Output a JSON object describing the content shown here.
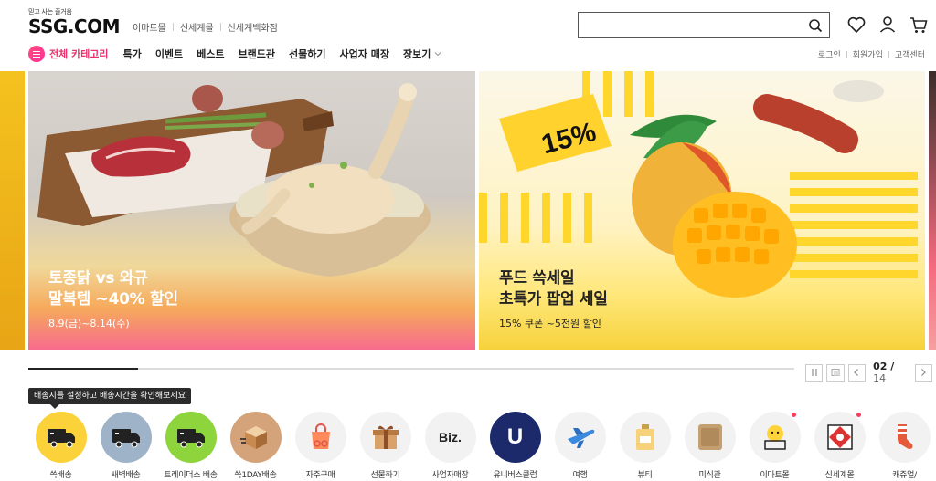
{
  "header": {
    "tagline": "믿고 사는 즐거움",
    "logo": "SSG.COM",
    "site_links": [
      "이마트몰",
      "신세계몰",
      "신세계백화점"
    ],
    "search": {
      "placeholder": "",
      "value": ""
    }
  },
  "nav": {
    "all_categories": "전체 카테고리",
    "items": [
      "특가",
      "이벤트",
      "베스트",
      "브랜드관",
      "선물하기",
      "사업자 매장",
      "장보기"
    ],
    "util_links": [
      "로그인",
      "회원가입",
      "고객센터"
    ]
  },
  "banners": [
    {
      "title_line1": "토종닭 vs 와규",
      "title_line2": "말복템 ~40% 할인",
      "sub": "8.9(금)~8.14(수)"
    },
    {
      "title_line1": "푸드 쓱세일",
      "title_line2": "초특가 팝업 세일",
      "sub": "15% 쿠폰 ~5천원 할인",
      "badge": "15%"
    }
  ],
  "carousel": {
    "current": "02",
    "total": "14",
    "progress": 0.143
  },
  "tooltip": "배송지를 설정하고 배송시간을 확인해보세요",
  "quick_menu": [
    {
      "label": "쓱배송",
      "icon": "truck-icon",
      "bg": "#fbd23a"
    },
    {
      "label": "새벽배송",
      "icon": "truck-icon",
      "bg": "#9fb3c8"
    },
    {
      "label": "트레이더스 배송",
      "icon": "truck-icon",
      "bg": "#8ed43c"
    },
    {
      "label": "쓱1DAY배송",
      "icon": "box-icon",
      "bg": "#d4a37a"
    },
    {
      "label": "자주구매",
      "icon": "shopping-bag-icon",
      "bg": "#f2f2f2"
    },
    {
      "label": "선물하기",
      "icon": "gift-icon",
      "bg": "#f2f2f2"
    },
    {
      "label": "사업자매장",
      "icon": "biz-icon",
      "bg": "#f2f2f2",
      "text": "Biz."
    },
    {
      "label": "유니버스클럽",
      "icon": "universe-icon",
      "bg": "#1c2a6b",
      "text": "U"
    },
    {
      "label": "여행",
      "icon": "airplane-icon",
      "bg": "#f2f2f2"
    },
    {
      "label": "뷰티",
      "icon": "perfume-icon",
      "bg": "#f2f2f2"
    },
    {
      "label": "미식관",
      "icon": "food-icon",
      "bg": "#f2f2f2"
    },
    {
      "label": "이마트몰",
      "icon": "emart-icon",
      "bg": "#f2f2f2",
      "dot": true
    },
    {
      "label": "신세계몰",
      "icon": "shinsegae-icon",
      "bg": "#f2f2f2",
      "dot": true
    },
    {
      "label": "캐쥬얼/",
      "icon": "socks-icon",
      "bg": "#f2f2f2"
    }
  ]
}
